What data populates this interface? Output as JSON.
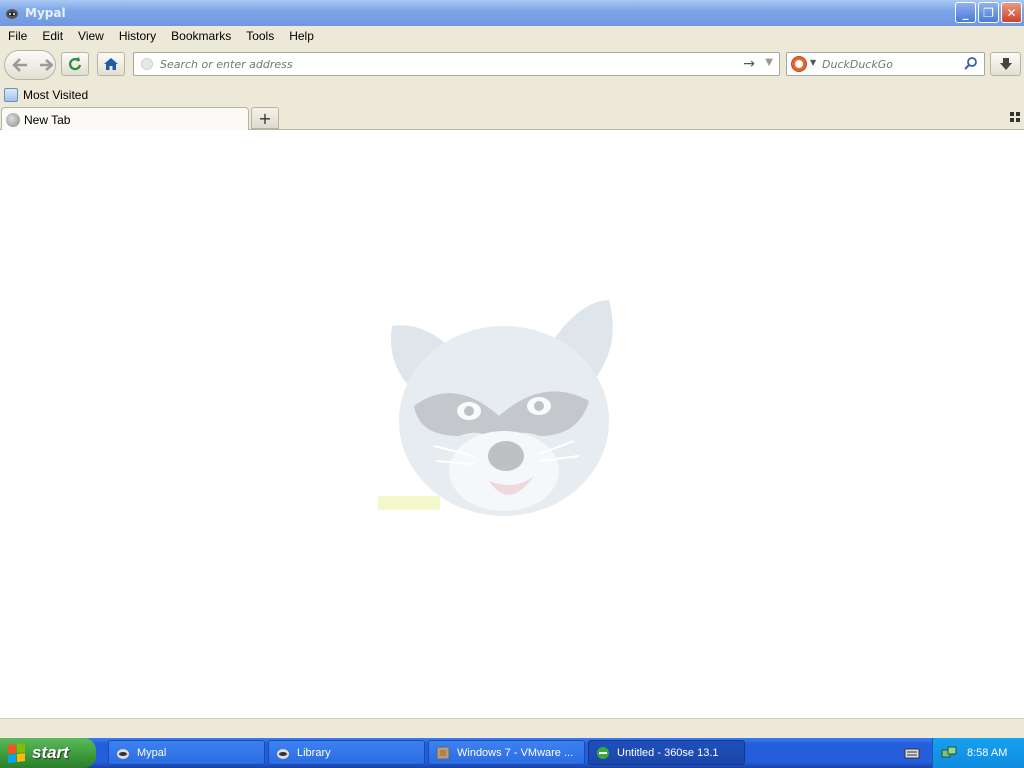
{
  "window": {
    "title": "Mypal",
    "icon": "raccoon-icon"
  },
  "menu": [
    "File",
    "Edit",
    "View",
    "History",
    "Bookmarks",
    "Tools",
    "Help"
  ],
  "toolbar": {
    "url_placeholder": "Search or enter address",
    "search_placeholder": "DuckDuckGo",
    "search_engine": "duckduckgo-icon"
  },
  "bookmarks": {
    "items": [
      {
        "label": "Most Visited",
        "icon": "bookmarks-folder-icon"
      }
    ]
  },
  "tabs": [
    {
      "label": "New Tab",
      "icon": "globe-icon"
    }
  ],
  "content": {
    "logo": "mypal-raccoon-logo"
  },
  "taskbar": {
    "start_label": "start",
    "tasks": [
      {
        "label": "Mypal",
        "icon": "raccoon-icon",
        "active": false
      },
      {
        "label": "Library",
        "icon": "raccoon-icon",
        "active": false
      },
      {
        "label": "Windows 7 - VMware ...",
        "icon": "vmware-icon",
        "active": false
      },
      {
        "label": "Untitled - 360se 13.1",
        "icon": "360se-icon",
        "active": true
      }
    ],
    "clock": "8:58 AM"
  },
  "colors": {
    "titlebar": "#7ea7e9",
    "chrome": "#ece9d8",
    "taskbar": "#245edb",
    "start": "#3a9a3a",
    "tray": "#0f8ce0"
  }
}
